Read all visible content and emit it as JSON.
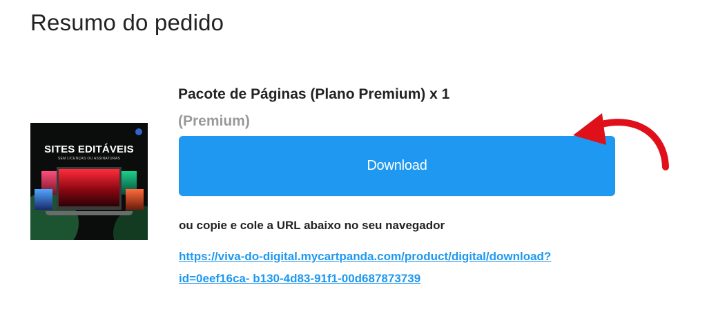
{
  "header": {
    "title": "Resumo do pedido"
  },
  "thumbnail": {
    "heading": "SITES EDITÁVEIS",
    "subheading": "SEM LICENÇAS OU ASSINATURAS"
  },
  "item": {
    "name": "Pacote de Páginas (Plano Premium) x 1",
    "variant": "(Premium)"
  },
  "actions": {
    "download_label": "Download",
    "copy_hint": "ou copie e cole a URL abaixo no seu navegador",
    "url_line1": "https://viva-do-digital.mycartpanda.com/product/digital/download?",
    "url_line2": "id=0eef16ca- b130-4d83-91f1-00d687873739"
  },
  "colors": {
    "accent": "#1e98f0",
    "annotation_arrow": "#e0101a",
    "variant_text": "#999999"
  },
  "icons": {
    "annotation": "curved-arrow-icon"
  }
}
